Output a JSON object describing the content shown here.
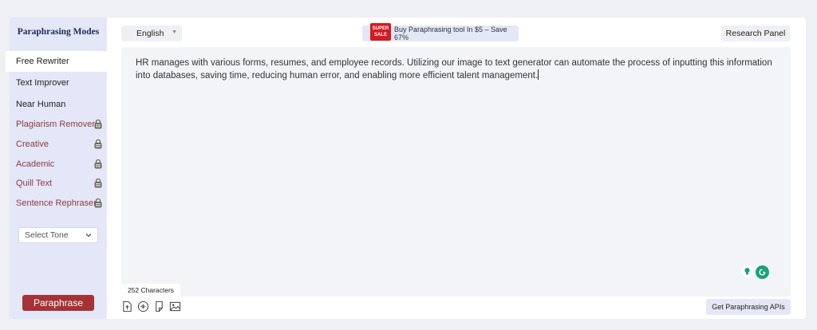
{
  "sidebar": {
    "title": "Paraphrasing Modes",
    "modes": [
      {
        "label": "Free Rewriter",
        "locked": false,
        "active": true
      },
      {
        "label": "Text Improver",
        "locked": false
      },
      {
        "label": "Near Human",
        "locked": false
      },
      {
        "label": "Plagiarism Remover",
        "locked": true
      },
      {
        "label": "Creative",
        "locked": true
      },
      {
        "label": "Academic",
        "locked": true
      },
      {
        "label": "Quill Text",
        "locked": true
      },
      {
        "label": "Sentence Rephraser",
        "locked": true
      }
    ],
    "tone_placeholder": "Select Tone",
    "paraphrase_label": "Paraphrase"
  },
  "header": {
    "language": "English",
    "promo_badge_line1": "SUPER",
    "promo_badge_line2": "SALE",
    "promo_text": "Buy Paraphrasing tool In $5 – Save 67%",
    "research_label": "Research Panel"
  },
  "editor": {
    "text": "HR manages with various forms, resumes, and employee records. Utilizing our image to text generator can automate the process of inputting this information into databases, saving time, reducing human error, and enabling more efficient talent management.",
    "char_count": "252 Characters"
  },
  "footer": {
    "api_label": "Get Paraphrasing APIs",
    "tools": [
      "upload-icon",
      "audio-icon",
      "document-icon",
      "image-icon"
    ]
  },
  "colors": {
    "accent": "#a53234",
    "locked_text": "#8e3a44",
    "sidebar_bg": "#e3e7f7",
    "promo_bg": "#e4e8f6",
    "sale_red": "#d7191f",
    "grammar_green": "#17a37a"
  }
}
